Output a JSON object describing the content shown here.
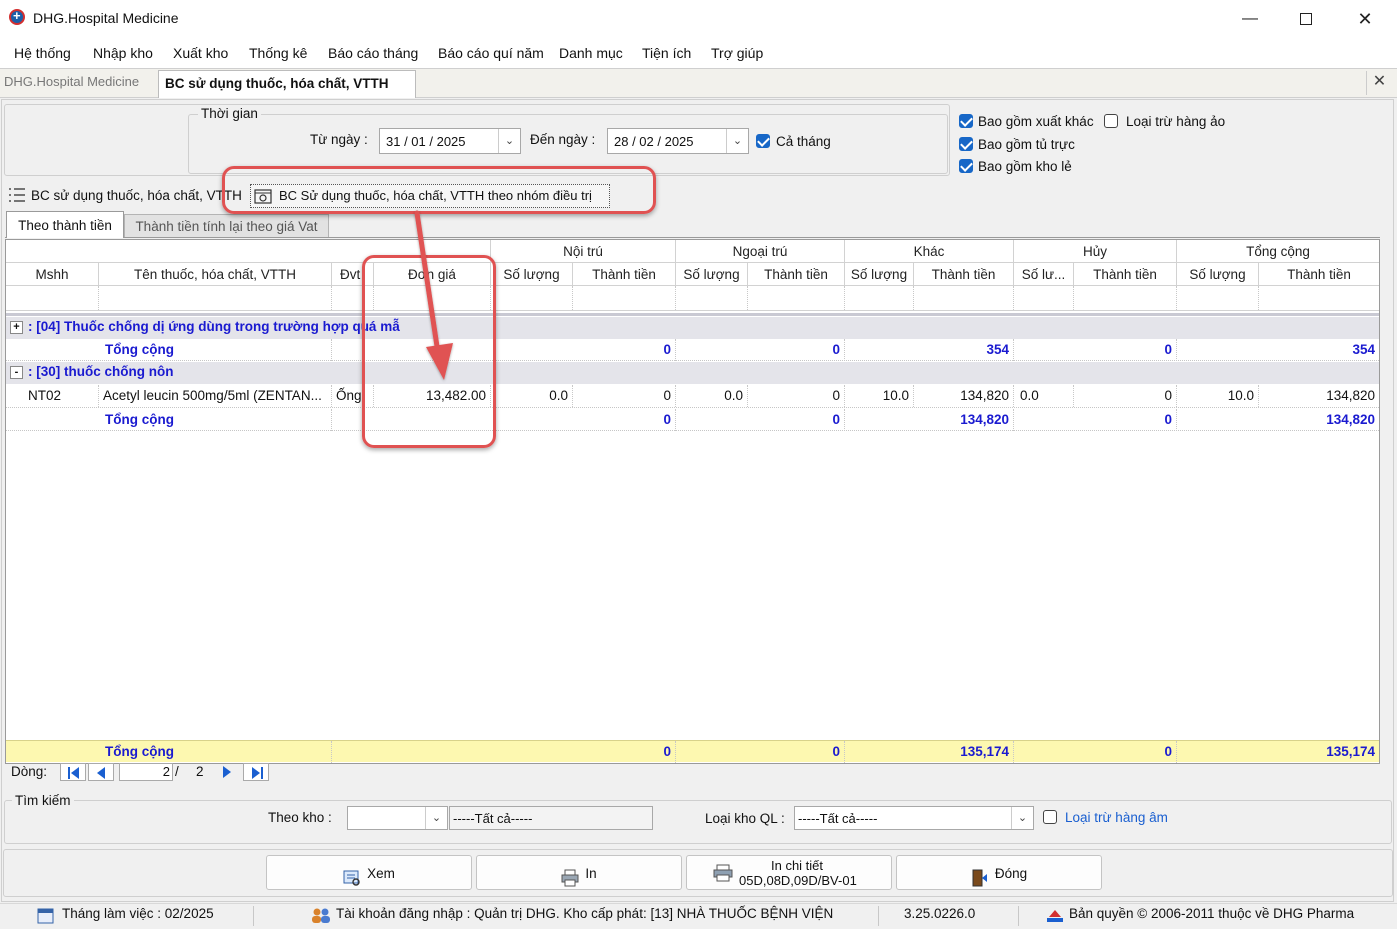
{
  "window": {
    "title": "DHG.Hospital Medicine"
  },
  "menu": [
    "Hệ thống",
    "Nhập kho",
    "Xuất kho",
    "Thống kê",
    "Báo cáo tháng",
    "Báo cáo quí năm",
    "Danh mục",
    "Tiện ích",
    "Trợ giúp"
  ],
  "doc_tabs": {
    "home": "DHG.Hospital Medicine",
    "active": "BC sử dụng thuốc, hóa chất, VTTH",
    "close": "✕"
  },
  "filter": {
    "group_title": "Thời gian",
    "from_label": "Từ ngày :",
    "from_value": "31 / 01 / 2025",
    "to_label": "Đến ngày :",
    "to_value": "28 / 02 / 2025",
    "whole_month_label": "Cả tháng",
    "whole_month_checked": true
  },
  "options": {
    "include_other_export": "Bao gồm xuất khác",
    "exclude_virtual": "Loại trừ hàng ảo",
    "include_duty_cabinet": "Bao gồm tủ trực",
    "include_retail_store": "Bao gồm kho lẻ"
  },
  "report_links": {
    "report1": "BC sử dụng thuốc, hóa chất, VTTH",
    "report2": "BC Sử dụng thuốc, hóa chất, VTTH theo nhóm điều trị"
  },
  "inner_tabs": {
    "tab1": "Theo thành tiền",
    "tab2": "Thành tiền tính lại theo giá Vat"
  },
  "grid": {
    "bands": {
      "inpatient": "Nội trú",
      "outpatient": "Ngoại trú",
      "other": "Khác",
      "cancel": "Hủy",
      "total": "Tổng cộng"
    },
    "columns": {
      "code": "Mshh",
      "name": "Tên thuốc, hóa chất, VTTH",
      "unit": "Đvt",
      "price": "Đơn giá",
      "qty": "Số lượng",
      "amount": "Thành tiền",
      "qty_short": "Số lư..."
    },
    "groups": [
      {
        "expander": "+",
        "title": ": [04] Thuốc chống dị ứng dùng trong trường hợp quá mẫ",
        "subtotal_label": "Tổng cộng",
        "subtotal": {
          "noi_tien": "0",
          "ngoai_tien": "0",
          "khac_tien": "354",
          "huy_tien": "0",
          "tong_tien": "354"
        }
      },
      {
        "expander": "-",
        "title": ": [30] thuốc chống nôn",
        "row": {
          "code": "NT02",
          "name": "Acetyl leucin 500mg/5ml (ZENTAN...",
          "unit": "Ống",
          "price": "13,482.00",
          "noi_sl": "0.0",
          "noi_tien": "0",
          "ngoai_sl": "0.0",
          "ngoai_tien": "0",
          "khac_sl": "10.0",
          "khac_tien": "134,820",
          "huy_sl": "0.0",
          "huy_tien": "0",
          "tong_sl": "10.0",
          "tong_tien": "134,820"
        },
        "subtotal_label": "Tổng cộng",
        "subtotal": {
          "noi_tien": "0",
          "ngoai_tien": "0",
          "khac_tien": "134,820",
          "huy_tien": "0",
          "tong_tien": "134,820"
        }
      }
    ],
    "footer": {
      "label": "Tổng cộng",
      "noi_tien": "0",
      "ngoai_tien": "0",
      "khac_tien": "135,174",
      "huy_tien": "0",
      "tong_tien": "135,174"
    }
  },
  "pager": {
    "label": "Dòng:",
    "current": "2",
    "sep": "/",
    "total": "2"
  },
  "search": {
    "group_title": "Tìm kiếm",
    "store_label": "Theo kho :",
    "store_value": "-----Tất cả-----",
    "store_type_label": "Loại kho QL :",
    "store_type_value": "-----Tất cả-----",
    "exclude_negative": "Loại trừ hàng âm"
  },
  "buttons": {
    "view": "Xem",
    "print": "In",
    "print_detail_1": "In chi tiết",
    "print_detail_2": "05D,08D,09D/BV-01",
    "close": "Đóng"
  },
  "status": {
    "working_month": "Tháng làm việc : 02/2025",
    "account": "Tài khoản đăng nhập : Quản trị DHG. Kho cấp phát: [13] NHÀ THUỐC BỆNH VIỆN",
    "version": "3.25.0226.0",
    "copyright": "Bản quyền © 2006-2011 thuộc về DHG Pharma"
  },
  "colors": {
    "accent": "#1767c7",
    "total_blue": "#1a1ad0",
    "highlight_red": "#e05252",
    "footer_yellow": "#fdf8b0"
  }
}
